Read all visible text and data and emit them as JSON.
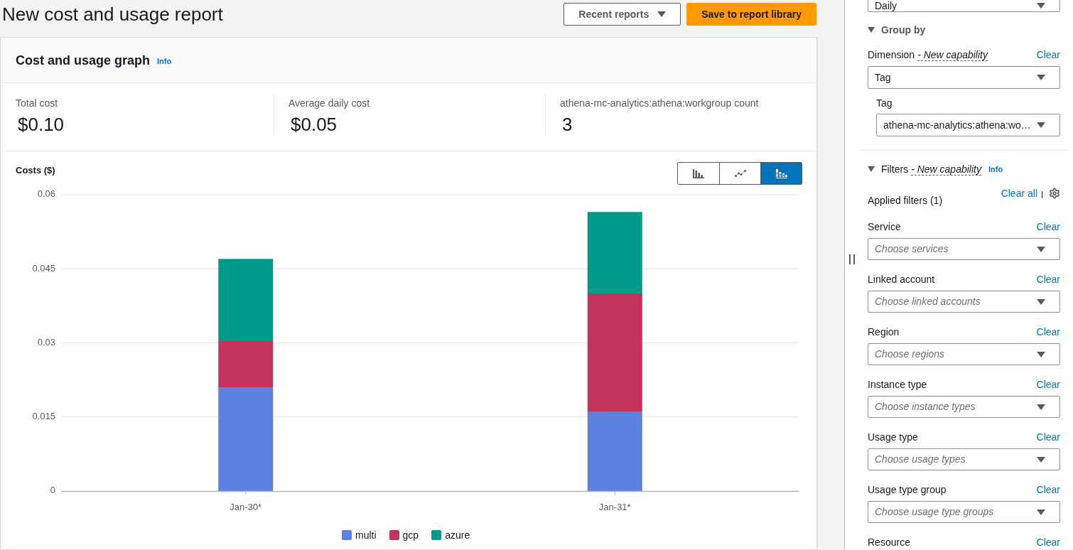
{
  "header": {
    "title": "New cost and usage report",
    "buttons": [
      {
        "label": "Recent reports",
        "kind": "dropdown"
      },
      {
        "label": "Save to report library",
        "kind": "primary"
      }
    ]
  },
  "graph_card": {
    "title": "Cost and usage graph",
    "info": "Info",
    "metrics": [
      {
        "label": "Total cost",
        "value": "$0.10"
      },
      {
        "label": "Average daily cost",
        "value": "$0.05"
      },
      {
        "label": "athena-mc-analytics:athena:workgroup count",
        "value": "3"
      }
    ],
    "chart_types": [
      {
        "kind": "bar",
        "selected": false
      },
      {
        "kind": "line",
        "selected": false
      },
      {
        "kind": "stacked",
        "selected": true
      }
    ],
    "chart_data": {
      "type": "bar",
      "stacked": true,
      "grid": true,
      "ylabel": "Costs ($)",
      "categories": [
        "Jan-30*",
        "Jan-31*"
      ],
      "series": [
        {
          "name": "multi",
          "color": "#5e80e0",
          "values": [
            0.021,
            0.016
          ]
        },
        {
          "name": "gcp",
          "color": "#c4335b",
          "values": [
            0.0095,
            0.024
          ]
        },
        {
          "name": "azure",
          "color": "#00998a",
          "values": [
            0.0165,
            0.0165
          ]
        }
      ],
      "ylim": [
        0,
        0.06
      ],
      "yticks": [
        0,
        0.015,
        0.03,
        0.045,
        0.06
      ]
    }
  },
  "sidebar": {
    "granularity": {
      "value": "Daily"
    },
    "group_by": {
      "title": "Group by",
      "expanded": true,
      "dimension": {
        "label": "Dimension",
        "note": "- New capability",
        "clear": "Clear",
        "value": "Tag"
      },
      "tag": {
        "label": "Tag",
        "value": "athena-mc-analytics:athena:wo…"
      }
    },
    "filters": {
      "title": "Filters",
      "note": "- New capability",
      "info": "Info",
      "expanded": true,
      "applied": "Applied filters (1)",
      "clear_all": "Clear all",
      "fields": [
        {
          "label": "Service",
          "clear": "Clear",
          "placeholder": "Choose services"
        },
        {
          "label": "Linked account",
          "clear": "Clear",
          "placeholder": "Choose linked accounts"
        },
        {
          "label": "Region",
          "clear": "Clear",
          "placeholder": "Choose regions"
        },
        {
          "label": "Instance type",
          "clear": "Clear",
          "placeholder": "Choose instance types"
        },
        {
          "label": "Usage type",
          "clear": "Clear",
          "placeholder": "Choose usage types"
        },
        {
          "label": "Usage type group",
          "clear": "Clear",
          "placeholder": "Choose usage type groups"
        },
        {
          "label": "Resource",
          "clear": "Clear"
        }
      ]
    }
  }
}
